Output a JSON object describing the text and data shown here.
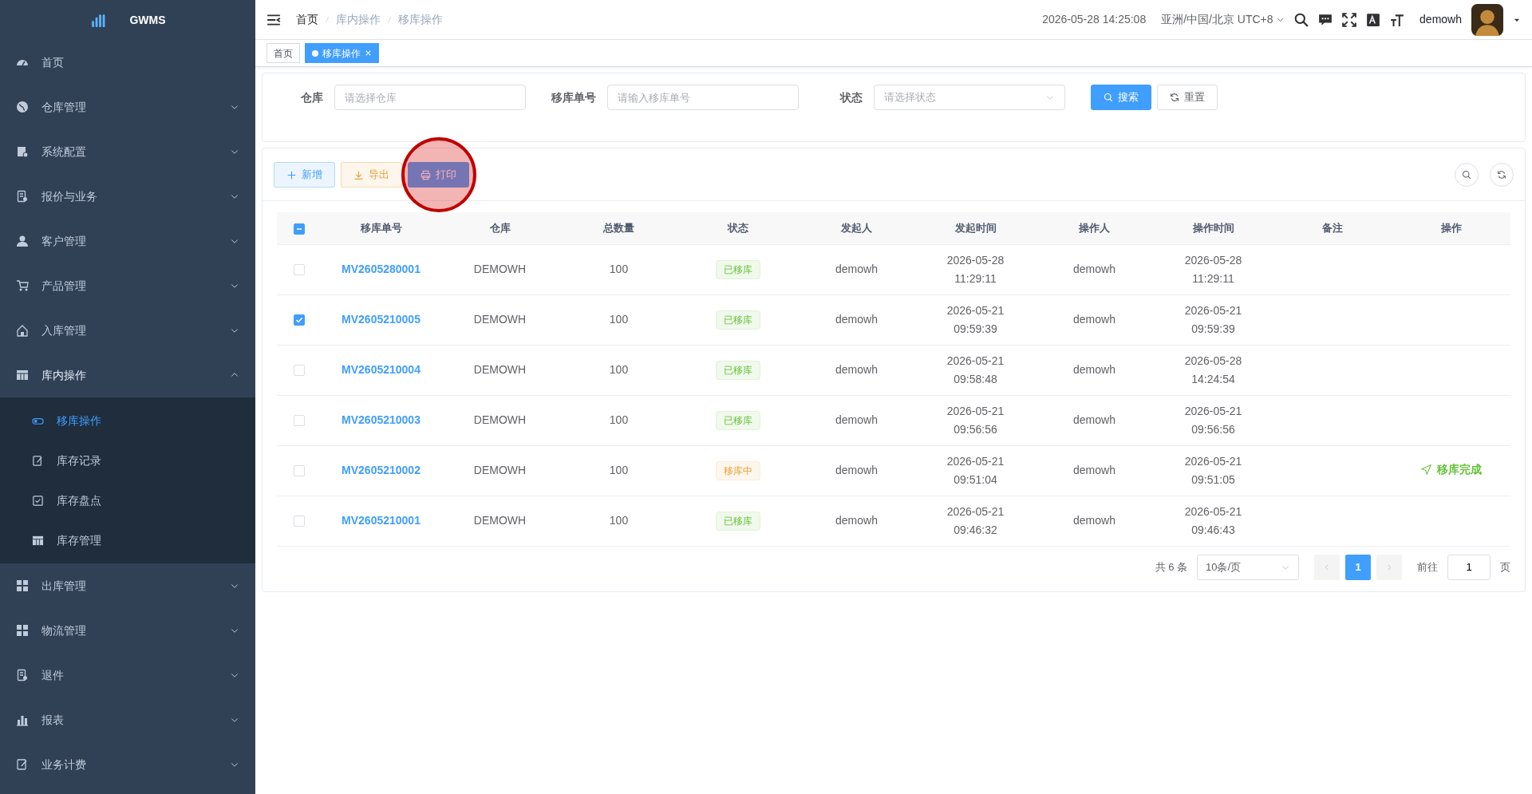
{
  "sidebar": {
    "logo": "GWMS",
    "items": [
      {
        "label": "首页"
      },
      {
        "label": "仓库管理",
        "expanded": false
      },
      {
        "label": "系统配置",
        "expanded": false
      },
      {
        "label": "报价与业务",
        "expanded": false
      },
      {
        "label": "客户管理",
        "expanded": false
      },
      {
        "label": "产品管理",
        "expanded": false
      },
      {
        "label": "入库管理",
        "expanded": false
      },
      {
        "label": "库内操作",
        "expanded": true,
        "children": [
          {
            "label": "移库操作",
            "selected": true
          },
          {
            "label": "库存记录",
            "selected": false
          },
          {
            "label": "库存盘点",
            "selected": false
          },
          {
            "label": "库存管理",
            "selected": false
          }
        ]
      },
      {
        "label": "出库管理",
        "expanded": false
      },
      {
        "label": "物流管理",
        "expanded": false
      },
      {
        "label": "退件",
        "expanded": false
      },
      {
        "label": "报表",
        "expanded": false
      },
      {
        "label": "业务计费",
        "expanded": false
      }
    ]
  },
  "header": {
    "breadcrumbs": [
      "首页",
      "库内操作",
      "移库操作"
    ],
    "datetime": "2026-05-28 14:25:08",
    "timezone": "亚洲/中国/北京 UTC+8",
    "username": "demowh"
  },
  "tags": [
    {
      "label": "首页",
      "selected": false
    },
    {
      "label": "移库操作",
      "selected": true
    }
  ],
  "search": {
    "fields": [
      {
        "label": "仓库",
        "placeholder": "请选择仓库",
        "kind": "input"
      },
      {
        "label": "移库单号",
        "placeholder": "请输入移库单号",
        "kind": "input"
      },
      {
        "label": "状态",
        "placeholder": "请选择状态",
        "kind": "select"
      }
    ],
    "buttons": [
      {
        "label": "搜索",
        "kind": "primary"
      },
      {
        "label": "重置",
        "kind": "plain"
      }
    ]
  },
  "toolbar": [
    {
      "label": "新增",
      "kind": "add",
      "clicked": false
    },
    {
      "label": "导出",
      "kind": "export",
      "clicked": false
    },
    {
      "label": "打印",
      "kind": "print",
      "clicked": true
    }
  ],
  "table": {
    "select_all_partial": true,
    "columns": [
      "移库单号",
      "仓库",
      "总数量",
      "状态",
      "发起人",
      "发起时间",
      "操作人",
      "操作时间",
      "备注",
      "操作"
    ],
    "rows": [
      {
        "checked": false,
        "no": "MV2605280001",
        "warehouse": "DEMOWH",
        "qty": "100",
        "status": {
          "text": "已移库",
          "kind": "done"
        },
        "initiator": "demowh",
        "start": [
          "2026-05-28",
          "11:29:11"
        ],
        "operator": "demowh",
        "op_time": [
          "2026-05-28",
          "11:29:11"
        ]
      },
      {
        "checked": true,
        "no": "MV2605210005",
        "warehouse": "DEMOWH",
        "qty": "100",
        "status": {
          "text": "已移库",
          "kind": "done"
        },
        "initiator": "demowh",
        "start": [
          "2026-05-21",
          "09:59:39"
        ],
        "operator": "demowh",
        "op_time": [
          "2026-05-21",
          "09:59:39"
        ]
      },
      {
        "checked": false,
        "no": "MV2605210004",
        "warehouse": "DEMOWH",
        "qty": "100",
        "status": {
          "text": "已移库",
          "kind": "done"
        },
        "initiator": "demowh",
        "start": [
          "2026-05-21",
          "09:58:48"
        ],
        "operator": "demowh",
        "op_time": [
          "2026-05-28",
          "14:24:54"
        ]
      },
      {
        "checked": false,
        "no": "MV2605210003",
        "warehouse": "DEMOWH",
        "qty": "100",
        "status": {
          "text": "已移库",
          "kind": "done"
        },
        "initiator": "demowh",
        "start": [
          "2026-05-21",
          "09:56:56"
        ],
        "operator": "demowh",
        "op_time": [
          "2026-05-21",
          "09:56:56"
        ]
      },
      {
        "checked": false,
        "no": "MV2605210002",
        "warehouse": "DEMOWH",
        "qty": "100",
        "status": {
          "text": "移库中",
          "kind": "moving"
        },
        "initiator": "demowh",
        "start": [
          "2026-05-21",
          "09:51:04"
        ],
        "operator": "demowh",
        "op_time": [
          "2026-05-21",
          "09:51:05"
        ],
        "action": "移库完成"
      },
      {
        "checked": false,
        "no": "MV2605210001",
        "warehouse": "DEMOWH",
        "qty": "100",
        "status": {
          "text": "已移库",
          "kind": "done"
        },
        "initiator": "demowh",
        "start": [
          "2026-05-21",
          "09:46:32"
        ],
        "operator": "demowh",
        "op_time": [
          "2026-05-21",
          "09:46:43"
        ]
      }
    ]
  },
  "pagination": {
    "total": "共 6 条",
    "page_size": "10条/页",
    "pages": [
      {
        "label": "1",
        "selected": true
      }
    ],
    "goto_label": "前往",
    "goto_value": "1",
    "goto_suffix": "页"
  }
}
